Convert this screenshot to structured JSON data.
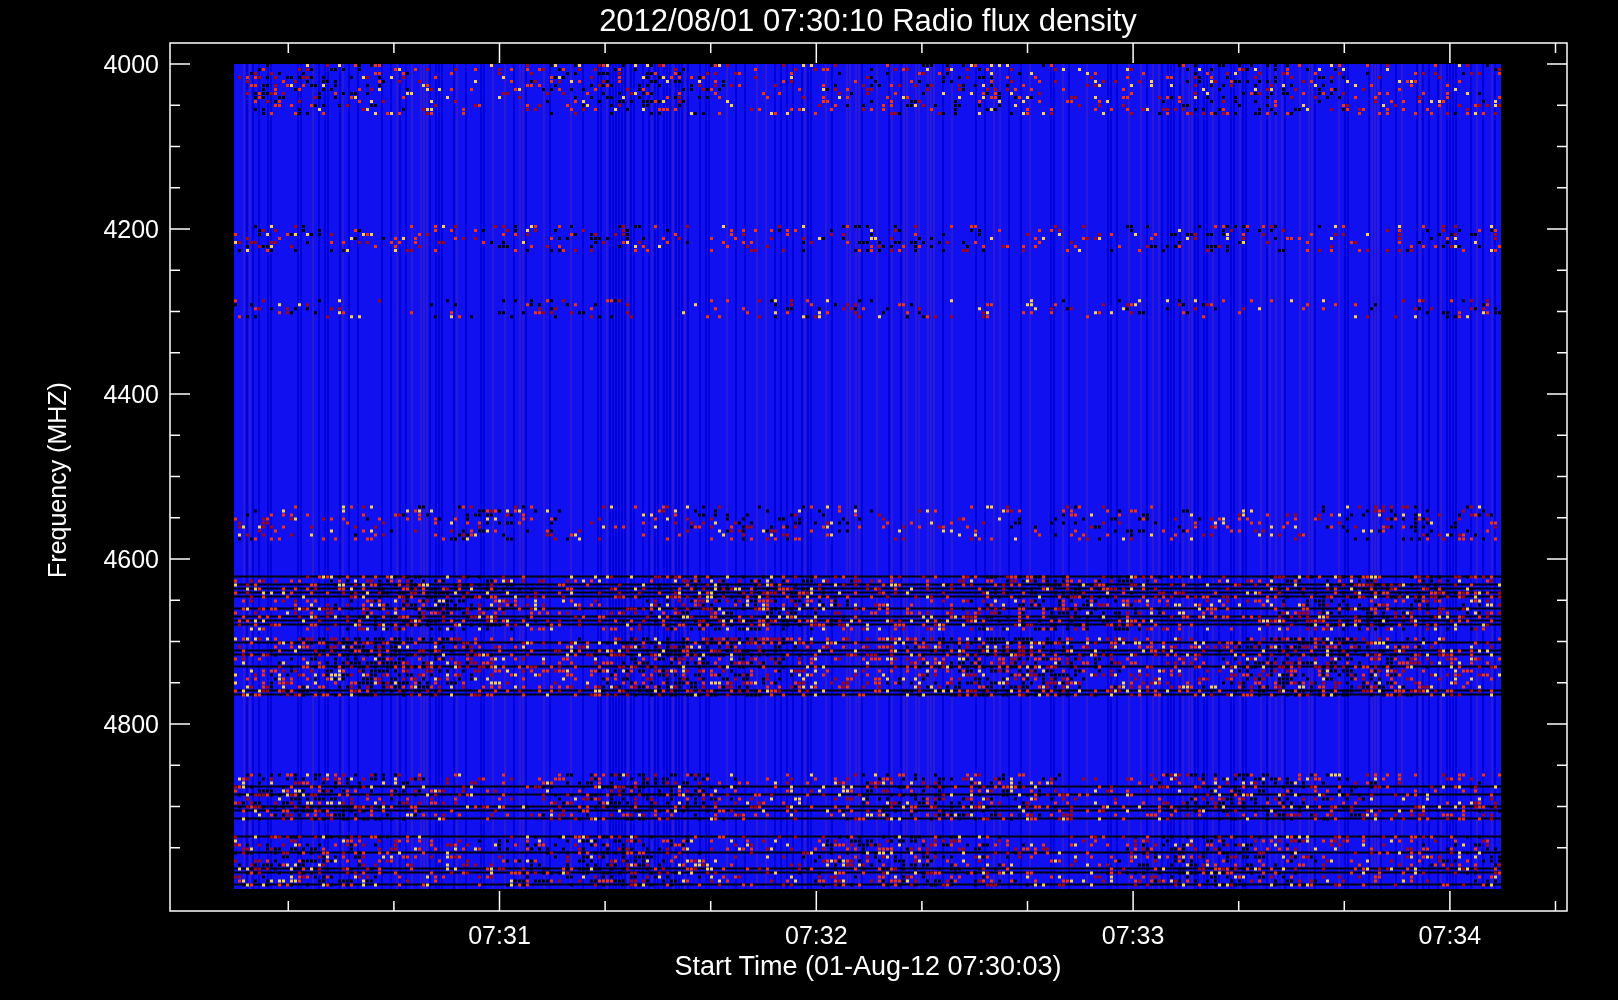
{
  "plot": {
    "title": "2012/08/01 07:30:10 Radio flux density",
    "ylabel": "Frequency (MHZ)",
    "xlabel": "Start Time (01-Aug-12 07:30:03)",
    "yticks": [
      "4000",
      "4200",
      "4400",
      "4600",
      "4800"
    ],
    "xticks": [
      "07:31",
      "07:32",
      "07:33",
      "07:34"
    ]
  }
}
